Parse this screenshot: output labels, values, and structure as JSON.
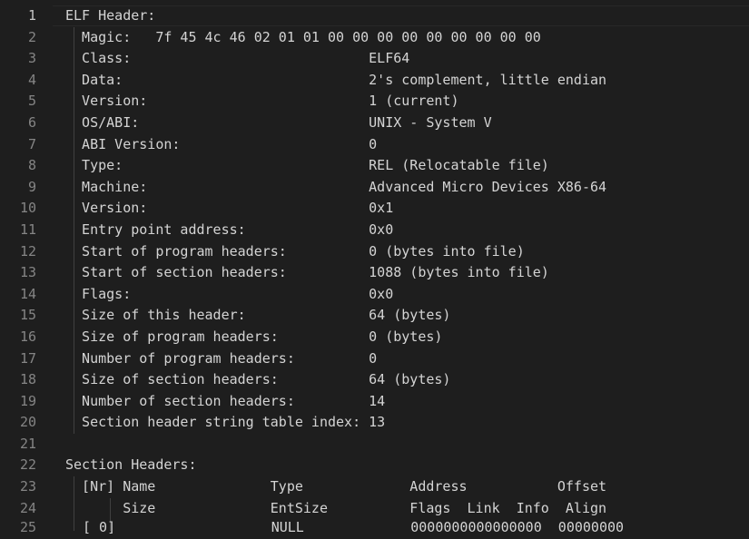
{
  "editor": {
    "line_numbers": [
      "1",
      "2",
      "3",
      "4",
      "5",
      "6",
      "7",
      "8",
      "9",
      "10",
      "11",
      "12",
      "13",
      "14",
      "15",
      "16",
      "17",
      "18",
      "19",
      "20",
      "21",
      "22",
      "23",
      "24"
    ],
    "lines": [
      "ELF Header:",
      "  Magic:   7f 45 4c 46 02 01 01 00 00 00 00 00 00 00 00 00",
      "  Class:                             ELF64",
      "  Data:                              2's complement, little endian",
      "  Version:                           1 (current)",
      "  OS/ABI:                            UNIX - System V",
      "  ABI Version:                       0",
      "  Type:                              REL (Relocatable file)",
      "  Machine:                           Advanced Micro Devices X86-64",
      "  Version:                           0x1",
      "  Entry point address:               0x0",
      "  Start of program headers:          0 (bytes into file)",
      "  Start of section headers:          1088 (bytes into file)",
      "  Flags:                             0x0",
      "  Size of this header:               64 (bytes)",
      "  Size of program headers:           0 (bytes)",
      "  Number of program headers:         0",
      "  Size of section headers:           64 (bytes)",
      "  Number of section headers:         14",
      "  Section header string table index: 13",
      "",
      "Section Headers:",
      "  [Nr] Name              Type             Address           Offset",
      "       Size              EntSize          Flags  Link  Info  Align"
    ],
    "partial_line_number": "25",
    "partial_line_text": "[ 0]                   NULL             0000000000000000  00000000"
  }
}
